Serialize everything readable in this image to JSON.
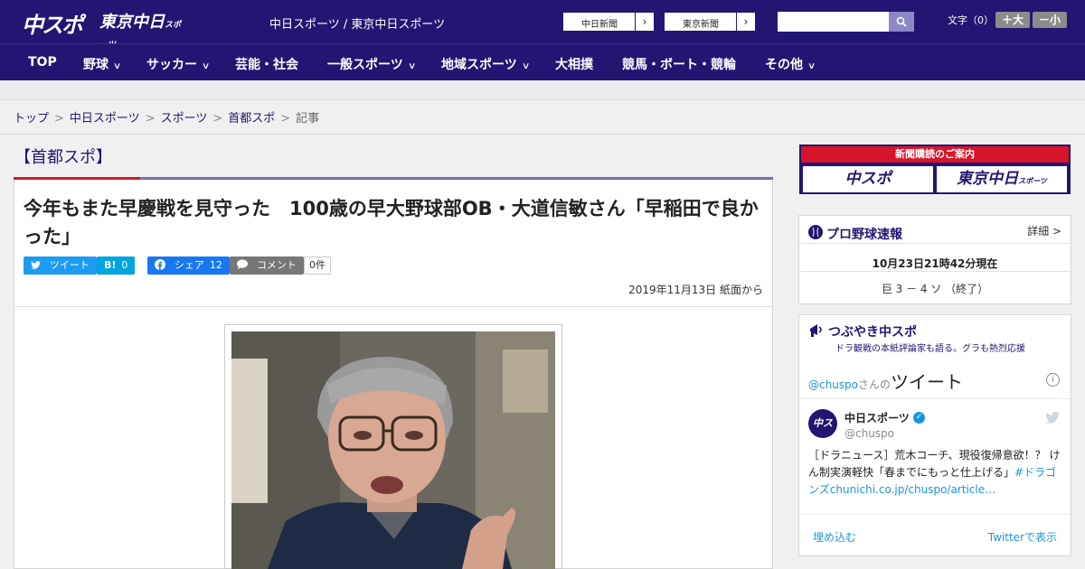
{
  "header": {
    "logo_chuspo": "中スポ",
    "logo_tokyo": "東京中日",
    "logo_tokyo_small": "スポーツ",
    "site_name": "中日スポーツ / 東京中日スポーツ",
    "link_chunichi": "中日新聞",
    "link_tokyo": "東京新聞",
    "search_placeholder": "",
    "font_label": "文字（0）",
    "font_larger": "＋大",
    "font_smaller": "－小"
  },
  "nav": {
    "items": [
      {
        "label": "TOP"
      },
      {
        "label": "野球"
      },
      {
        "label": "サッカー"
      },
      {
        "label": "芸能・社会"
      },
      {
        "label": "一般スポーツ"
      },
      {
        "label": "地域スポーツ"
      },
      {
        "label": "大相撲"
      },
      {
        "label": "競馬・ボート・競輪"
      },
      {
        "label": "その他"
      }
    ]
  },
  "breadcrumb": {
    "items": [
      "トップ",
      "中日スポーツ",
      "スポーツ",
      "首都スポ"
    ],
    "current": "記事",
    "separator": ">"
  },
  "article": {
    "section": "【首都スポ】",
    "headline": "今年もまた早慶戦を見守った　100歳の早大野球部OB・大道信敏さん「早稲田で良かった」",
    "share": {
      "tweet": "ツイート",
      "hatena_icon": "B!",
      "hatena_count": "0",
      "facebook": "シェア",
      "facebook_count": "12",
      "comment": "コメント",
      "comment_count": "0件"
    },
    "date": "2019年11月13日 紙面から"
  },
  "sidebar": {
    "banner_title": "新聞購読のご案内",
    "banner_chuspo": "中スポ",
    "banner_tokyo": "東京中日",
    "banner_tokyo_small": "スポーツ",
    "baseball": {
      "title": "プロ野球速報",
      "more": "詳細 >",
      "time": "10月23日21時42分現在",
      "score": "巨 3 － 4 ソ （終了）"
    },
    "twitter": {
      "title": "つぶやき中スポ",
      "subtitle": "ドラ観戦の本紙評論家も語る。グラも熱烈応援",
      "handle_link": "@chuspo",
      "san": "さんの",
      "tweet_word": "ツイート",
      "user_name": "中日スポーツ",
      "user_handle": "@chuspo",
      "avatar_text": "中スポ",
      "tweet_text": "［ドラニュース］荒木コーチ、現役復帰意欲！？ けん制実演軽快「春までにもっと仕上げる」",
      "tweet_hashtag": "#ドラゴンズ",
      "tweet_url": "chunichi.co.jp/chuspo/article…",
      "embed": "埋め込む",
      "view_on": "Twitterで表示"
    }
  },
  "colors": {
    "brand_navy": "#221672",
    "accent_red": "#d6142a",
    "twitter_blue": "#1b95e0",
    "facebook_blue": "#1877f2",
    "hatena_blue": "#1d9bf0"
  }
}
